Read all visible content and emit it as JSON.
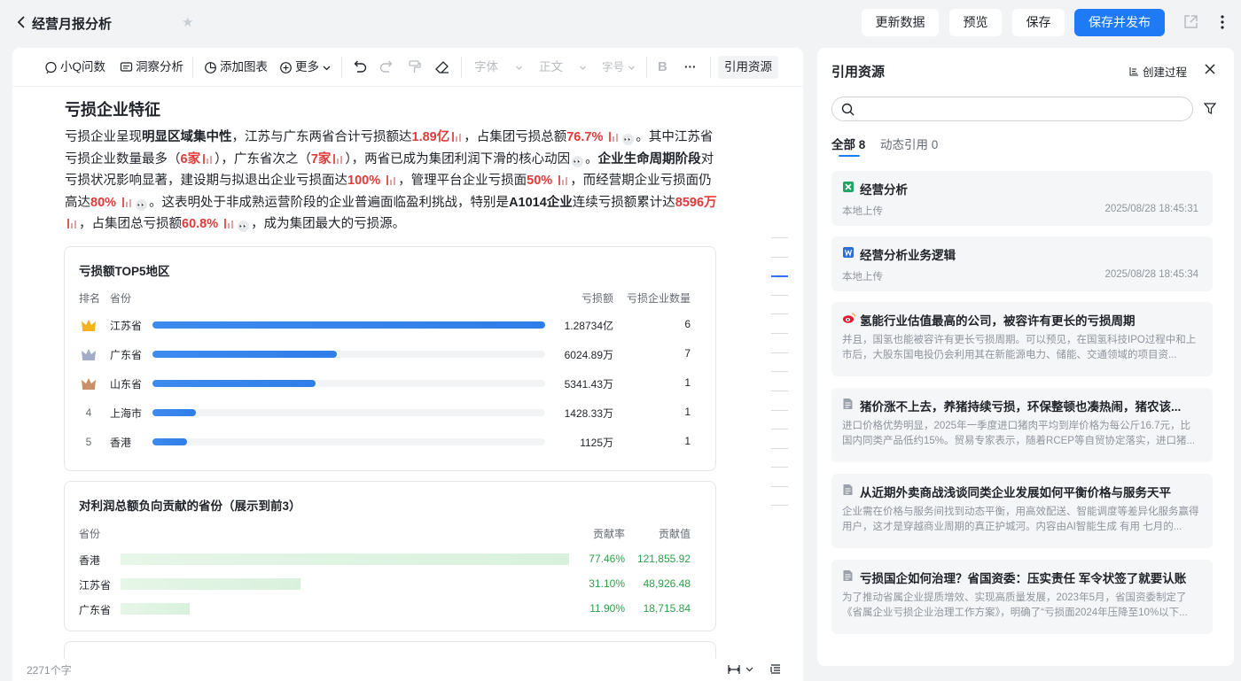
{
  "header": {
    "title": "经营月报分析",
    "buttons": {
      "refresh": "更新数据",
      "preview": "预览",
      "save": "保存",
      "save_publish": "保存并发布"
    }
  },
  "toolbar": {
    "ask": "小Q问数",
    "insight": "洞察分析",
    "add_chart": "添加图表",
    "more": "更多",
    "font": "字体",
    "style": "正文",
    "size": "字号",
    "bold": "B",
    "ellipsis": "···",
    "ref": "引用资源"
  },
  "doc": {
    "heading": "亏损企业特征",
    "p": {
      "t1": "亏损企业呈现",
      "b1": "明显区域集中性",
      "t2": "，江苏与广东两省合计亏损额达",
      "r1": "1.89亿",
      "t3": "，占集团亏损总额",
      "r2": "76.7%",
      "t4": "。其中江苏省亏损企业数量最多（",
      "r3": "6家",
      "t5": "），广东省次之（",
      "r4": "7家",
      "t6": "），两省已成为集团利润下滑的核心动因",
      "t7": "。",
      "b2": "企业生命周期阶段",
      "t8": "对亏损状况影响显著，建设期与拟退出企业亏损面达",
      "r5": "100%",
      "t9": "，管理平台企业亏损面",
      "r6": "50%",
      "t10": "，而经营期企业亏损面仍高达",
      "r7": "80%",
      "t11": "。这表明处于非成熟运营阶段的企业普遍面临盈利挑战，特别是",
      "b3": "A1014企业",
      "t12": "连续亏损额累计达",
      "r8": "8596万",
      "t13": "，占集团总亏损额",
      "r9": "60.8%",
      "t14": "，成为集团最大的亏损源。"
    }
  },
  "top5": {
    "title": "亏损额TOP5地区",
    "headers": {
      "rank": "排名",
      "province": "省份",
      "amount": "亏损额",
      "count": "亏损企业数量"
    },
    "rows": [
      {
        "rank": "1",
        "province": "江苏省",
        "amount": "1.28734亿",
        "count": "6",
        "pct": 100,
        "medal": "gold"
      },
      {
        "rank": "2",
        "province": "广东省",
        "amount": "6024.89万",
        "count": "7",
        "pct": 47,
        "medal": "silver"
      },
      {
        "rank": "3",
        "province": "山东省",
        "amount": "5341.43万",
        "count": "1",
        "pct": 41.5,
        "medal": "bronze"
      },
      {
        "rank": "4",
        "province": "上海市",
        "amount": "1428.33万",
        "count": "1",
        "pct": 11,
        "medal": ""
      },
      {
        "rank": "5",
        "province": "香港",
        "amount": "1125万",
        "count": "1",
        "pct": 8.7,
        "medal": ""
      }
    ]
  },
  "contrib": {
    "title": "对利润总额负向贡献的省份（展示到前3）",
    "headers": {
      "province": "省份",
      "rate": "贡献率",
      "value": "贡献值"
    },
    "rows": [
      {
        "province": "香港",
        "rate": "77.46%",
        "value": "121,855.92",
        "pct": 77.46
      },
      {
        "province": "江苏省",
        "rate": "31.10%",
        "value": "48,926.48",
        "pct": 31.1
      },
      {
        "province": "广东省",
        "rate": "11.90%",
        "value": "18,715.84",
        "pct": 11.9
      }
    ]
  },
  "footer": {
    "word_count": "2271个字"
  },
  "panel": {
    "title": "引用资源",
    "create": "创建过程",
    "search_placeholder": "",
    "tab_all": "全部",
    "tab_all_count": "8",
    "tab_dynamic": "动态引用 0",
    "items": [
      {
        "icon": "excel-icon",
        "title": "经营分析",
        "source": "本地上传",
        "time": "2025/08/28 18:45:31"
      },
      {
        "icon": "word-icon",
        "title": "经营分析业务逻辑",
        "source": "本地上传",
        "time": "2025/08/28 18:45:34"
      },
      {
        "icon": "weibo-icon",
        "title": "氢能行业估值最高的公司，被容许有更长的亏损周期",
        "body": "并且，国氢也能被容许有更长亏损周期。可以预见，在国氢科技IPO过程中和上市后，大股东国电投仍会利用其在新能源电力、储能、交通领域的项目资..."
      },
      {
        "icon": "doc-icon",
        "title": "猪价涨不上去，养猪持续亏损，环保整顿也凑热闹，猪农该...",
        "body": "进口价格优势明显，2025年一季度进口猪肉平均到岸价格为每公斤16.7元，比国内同类产品低约15%。贸易专家表示，随着RCEP等自贸协定落实，进口猪..."
      },
      {
        "icon": "doc-icon",
        "title": "从近期外卖商战浅谈同类企业发展如何平衡价格与服务天平",
        "body": "企业需在价格与服务间找到动态平衡，用高效配送、智能调度等差异化服务赢得用户，这才是穿越商业周期的真正护城河。内容由AI智能生成 有用 七月的..."
      },
      {
        "icon": "doc-icon",
        "title": "亏损国企如何治理？省国资委：压实责任 军令状签了就要认账",
        "body": "为了推动省属企业提质增效、实现高质量发展，2023年5月，省国资委制定了《省属企业亏损企业治理工作方案》，明确了“亏损面2024年压降至10%以下..."
      }
    ]
  }
}
